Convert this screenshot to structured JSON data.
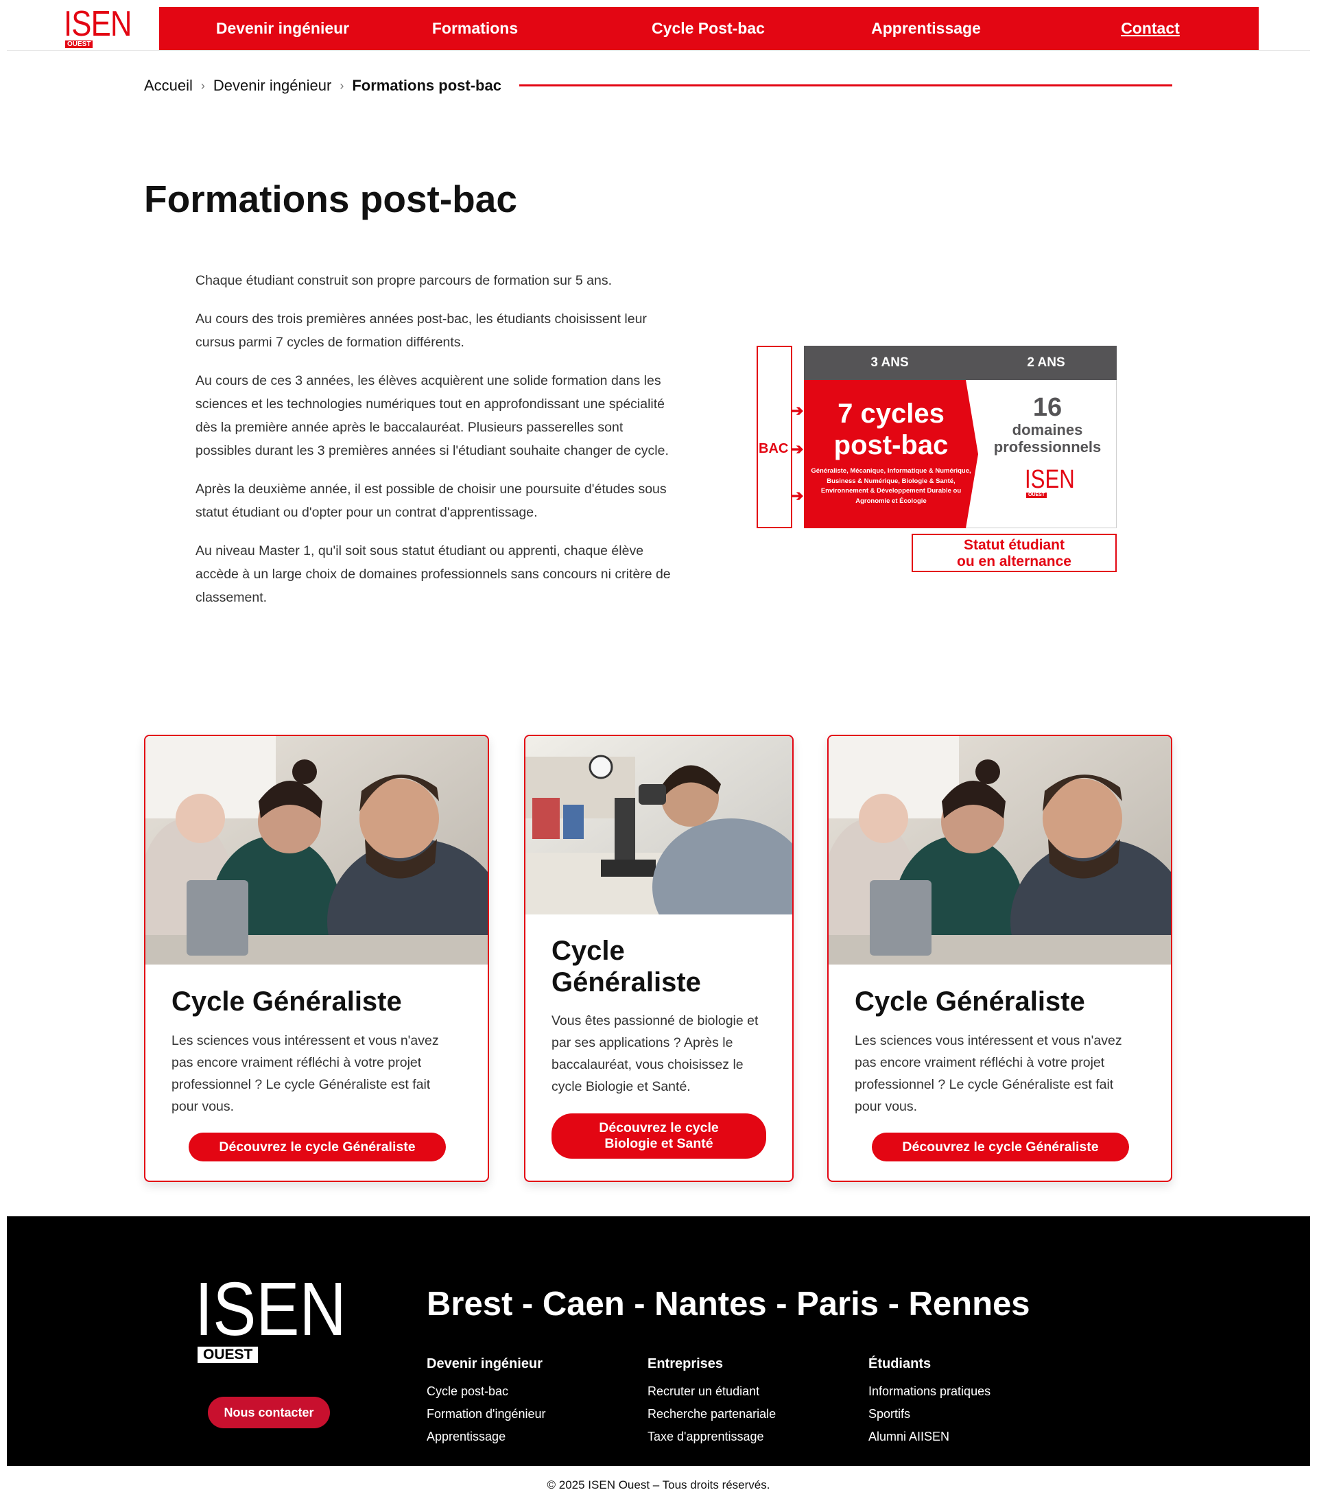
{
  "header": {
    "logo_text": "ISEN",
    "logo_badge": "OUEST",
    "nav": [
      "Devenir ingénieur",
      "Formations",
      "Cycle Post-bac",
      "Apprentissage",
      "Contact"
    ]
  },
  "breadcrumb": {
    "items": [
      "Accueil",
      "Devenir ingénieur"
    ],
    "current": "Formations post-bac",
    "separator": "›"
  },
  "page_title": "Formations post-bac",
  "intro": [
    "Chaque étudiant construit son propre parcours de formation sur 5 ans.",
    "Au cours des trois premières années post-bac, les étudiants choisissent leur cursus parmi 7 cycles de formation différents.",
    "Au cours de ces 3 années, les élèves acquièrent une solide formation dans les sciences et les technologies numériques tout en approfondissant une spécialité dès la première année après le baccalauréat. Plusieurs passerelles sont possibles durant les 3 premières années si l'étudiant souhaite changer de cycle.",
    "Après la deuxième année, il est possible de choisir une poursuite d'études sous statut étudiant ou d'opter pour un contrat d'apprentissage.",
    "Au niveau Master 1, qu'il soit sous statut étudiant ou apprenti, chaque élève accède à un large choix de domaines professionnels sans concours ni critère de classement."
  ],
  "diagram": {
    "bac_label": "BAC",
    "col1_header": "3 ANS",
    "col2_header": "2 ANS",
    "cycles_title_line1": "7 cycles",
    "cycles_title_line2": "post-bac",
    "cycles_list": "Généraliste, Mécanique, Informatique & Numérique, Business & Numérique, Biologie & Santé, Environnement & Développement Durable ou Agronomie et Écologie",
    "domains_number": "16",
    "domains_line1": "domaines",
    "domains_line2": "professionnels",
    "logo_text": "ISEN",
    "logo_badge": "OUEST",
    "status_line1": "Statut étudiant",
    "status_line2": "ou en alternance"
  },
  "cards": [
    {
      "title": "Cycle Généraliste",
      "text": "Les sciences vous intéressent et vous n'avez pas encore vraiment réfléchi à votre projet professionnel ? Le cycle Généraliste est fait pour vous.",
      "button": "Découvrez le cycle Généraliste"
    },
    {
      "title": "Cycle Généraliste",
      "text": "Vous êtes passionné de biologie et par ses applications ? Après le baccalauréat, vous choisissez le cycle Biologie et Santé.",
      "button_line1": "Découvrez le cycle",
      "button_line2": "Biologie et Santé"
    },
    {
      "title": "Cycle Généraliste",
      "text": "Les sciences vous intéressent et vous n'avez pas encore vraiment réfléchi à votre projet professionnel ? Le cycle Généraliste est fait pour vous.",
      "button": "Découvrez le cycle Généraliste"
    }
  ],
  "footer": {
    "logo_text": "ISEN",
    "logo_badge": "OUEST",
    "contact_button": "Nous contacter",
    "cities": "Brest - Caen - Nantes - Paris - Rennes",
    "columns": [
      {
        "title": "Devenir ingénieur",
        "links": [
          "Cycle post-bac",
          "Formation d'ingénieur",
          "Apprentissage"
        ]
      },
      {
        "title": "Entreprises",
        "links": [
          "Recruter un étudiant",
          "Recherche partenariale",
          "Taxe d'apprentissage"
        ]
      },
      {
        "title": "Étudiants",
        "links": [
          "Informations pratiques",
          "Sportifs",
          "Alumni AIISEN"
        ]
      }
    ]
  },
  "copyright": "© 2025 ISEN Ouest – Tous droits réservés.",
  "colors": {
    "brand_red": "#e30613",
    "dark_gray": "#555456",
    "footer_bg": "#000000"
  }
}
